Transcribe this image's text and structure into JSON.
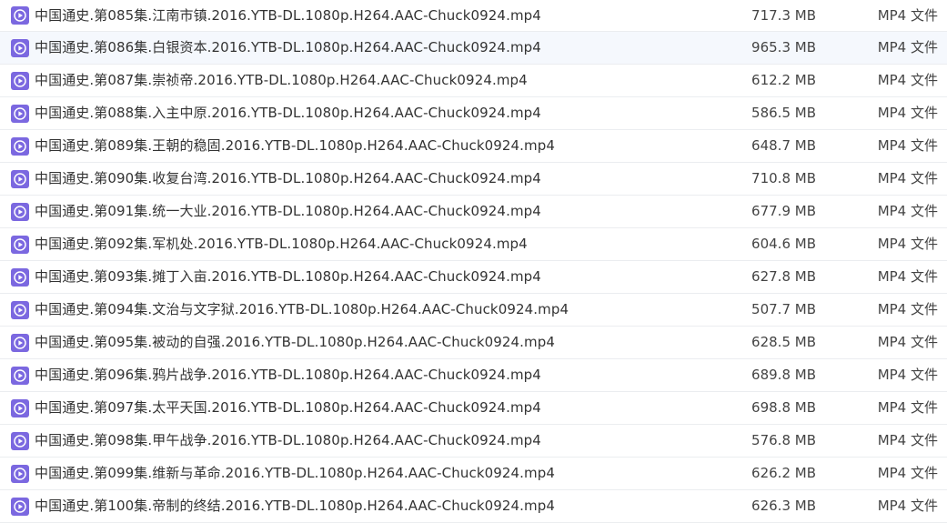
{
  "colors": {
    "icon_bg": "#7b68e0",
    "row_hover": "#f5f8fd",
    "divider": "#ebedf0"
  },
  "icon_name": "video-file-icon",
  "files": [
    {
      "name": "中国通史.第085集.江南市镇.2016.YTB-DL.1080p.H264.AAC-Chuck0924.mp4",
      "size": "717.3 MB",
      "type": "MP4 文件"
    },
    {
      "name": "中国通史.第086集.白银资本.2016.YTB-DL.1080p.H264.AAC-Chuck0924.mp4",
      "size": "965.3 MB",
      "type": "MP4 文件"
    },
    {
      "name": "中国通史.第087集.崇祯帝.2016.YTB-DL.1080p.H264.AAC-Chuck0924.mp4",
      "size": "612.2 MB",
      "type": "MP4 文件"
    },
    {
      "name": "中国通史.第088集.入主中原.2016.YTB-DL.1080p.H264.AAC-Chuck0924.mp4",
      "size": "586.5 MB",
      "type": "MP4 文件"
    },
    {
      "name": "中国通史.第089集.王朝的稳固.2016.YTB-DL.1080p.H264.AAC-Chuck0924.mp4",
      "size": "648.7 MB",
      "type": "MP4 文件"
    },
    {
      "name": "中国通史.第090集.收复台湾.2016.YTB-DL.1080p.H264.AAC-Chuck0924.mp4",
      "size": "710.8 MB",
      "type": "MP4 文件"
    },
    {
      "name": "中国通史.第091集.统一大业.2016.YTB-DL.1080p.H264.AAC-Chuck0924.mp4",
      "size": "677.9 MB",
      "type": "MP4 文件"
    },
    {
      "name": "中国通史.第092集.军机处.2016.YTB-DL.1080p.H264.AAC-Chuck0924.mp4",
      "size": "604.6 MB",
      "type": "MP4 文件"
    },
    {
      "name": "中国通史.第093集.摊丁入亩.2016.YTB-DL.1080p.H264.AAC-Chuck0924.mp4",
      "size": "627.8 MB",
      "type": "MP4 文件"
    },
    {
      "name": "中国通史.第094集.文治与文字狱.2016.YTB-DL.1080p.H264.AAC-Chuck0924.mp4",
      "size": "507.7 MB",
      "type": "MP4 文件"
    },
    {
      "name": "中国通史.第095集.被动的自强.2016.YTB-DL.1080p.H264.AAC-Chuck0924.mp4",
      "size": "628.5 MB",
      "type": "MP4 文件"
    },
    {
      "name": "中国通史.第096集.鸦片战争.2016.YTB-DL.1080p.H264.AAC-Chuck0924.mp4",
      "size": "689.8 MB",
      "type": "MP4 文件"
    },
    {
      "name": "中国通史.第097集.太平天国.2016.YTB-DL.1080p.H264.AAC-Chuck0924.mp4",
      "size": "698.8 MB",
      "type": "MP4 文件"
    },
    {
      "name": "中国通史.第098集.甲午战争.2016.YTB-DL.1080p.H264.AAC-Chuck0924.mp4",
      "size": "576.8 MB",
      "type": "MP4 文件"
    },
    {
      "name": "中国通史.第099集.维新与革命.2016.YTB-DL.1080p.H264.AAC-Chuck0924.mp4",
      "size": "626.2 MB",
      "type": "MP4 文件"
    },
    {
      "name": "中国通史.第100集.帝制的终结.2016.YTB-DL.1080p.H264.AAC-Chuck0924.mp4",
      "size": "626.3 MB",
      "type": "MP4 文件"
    }
  ]
}
